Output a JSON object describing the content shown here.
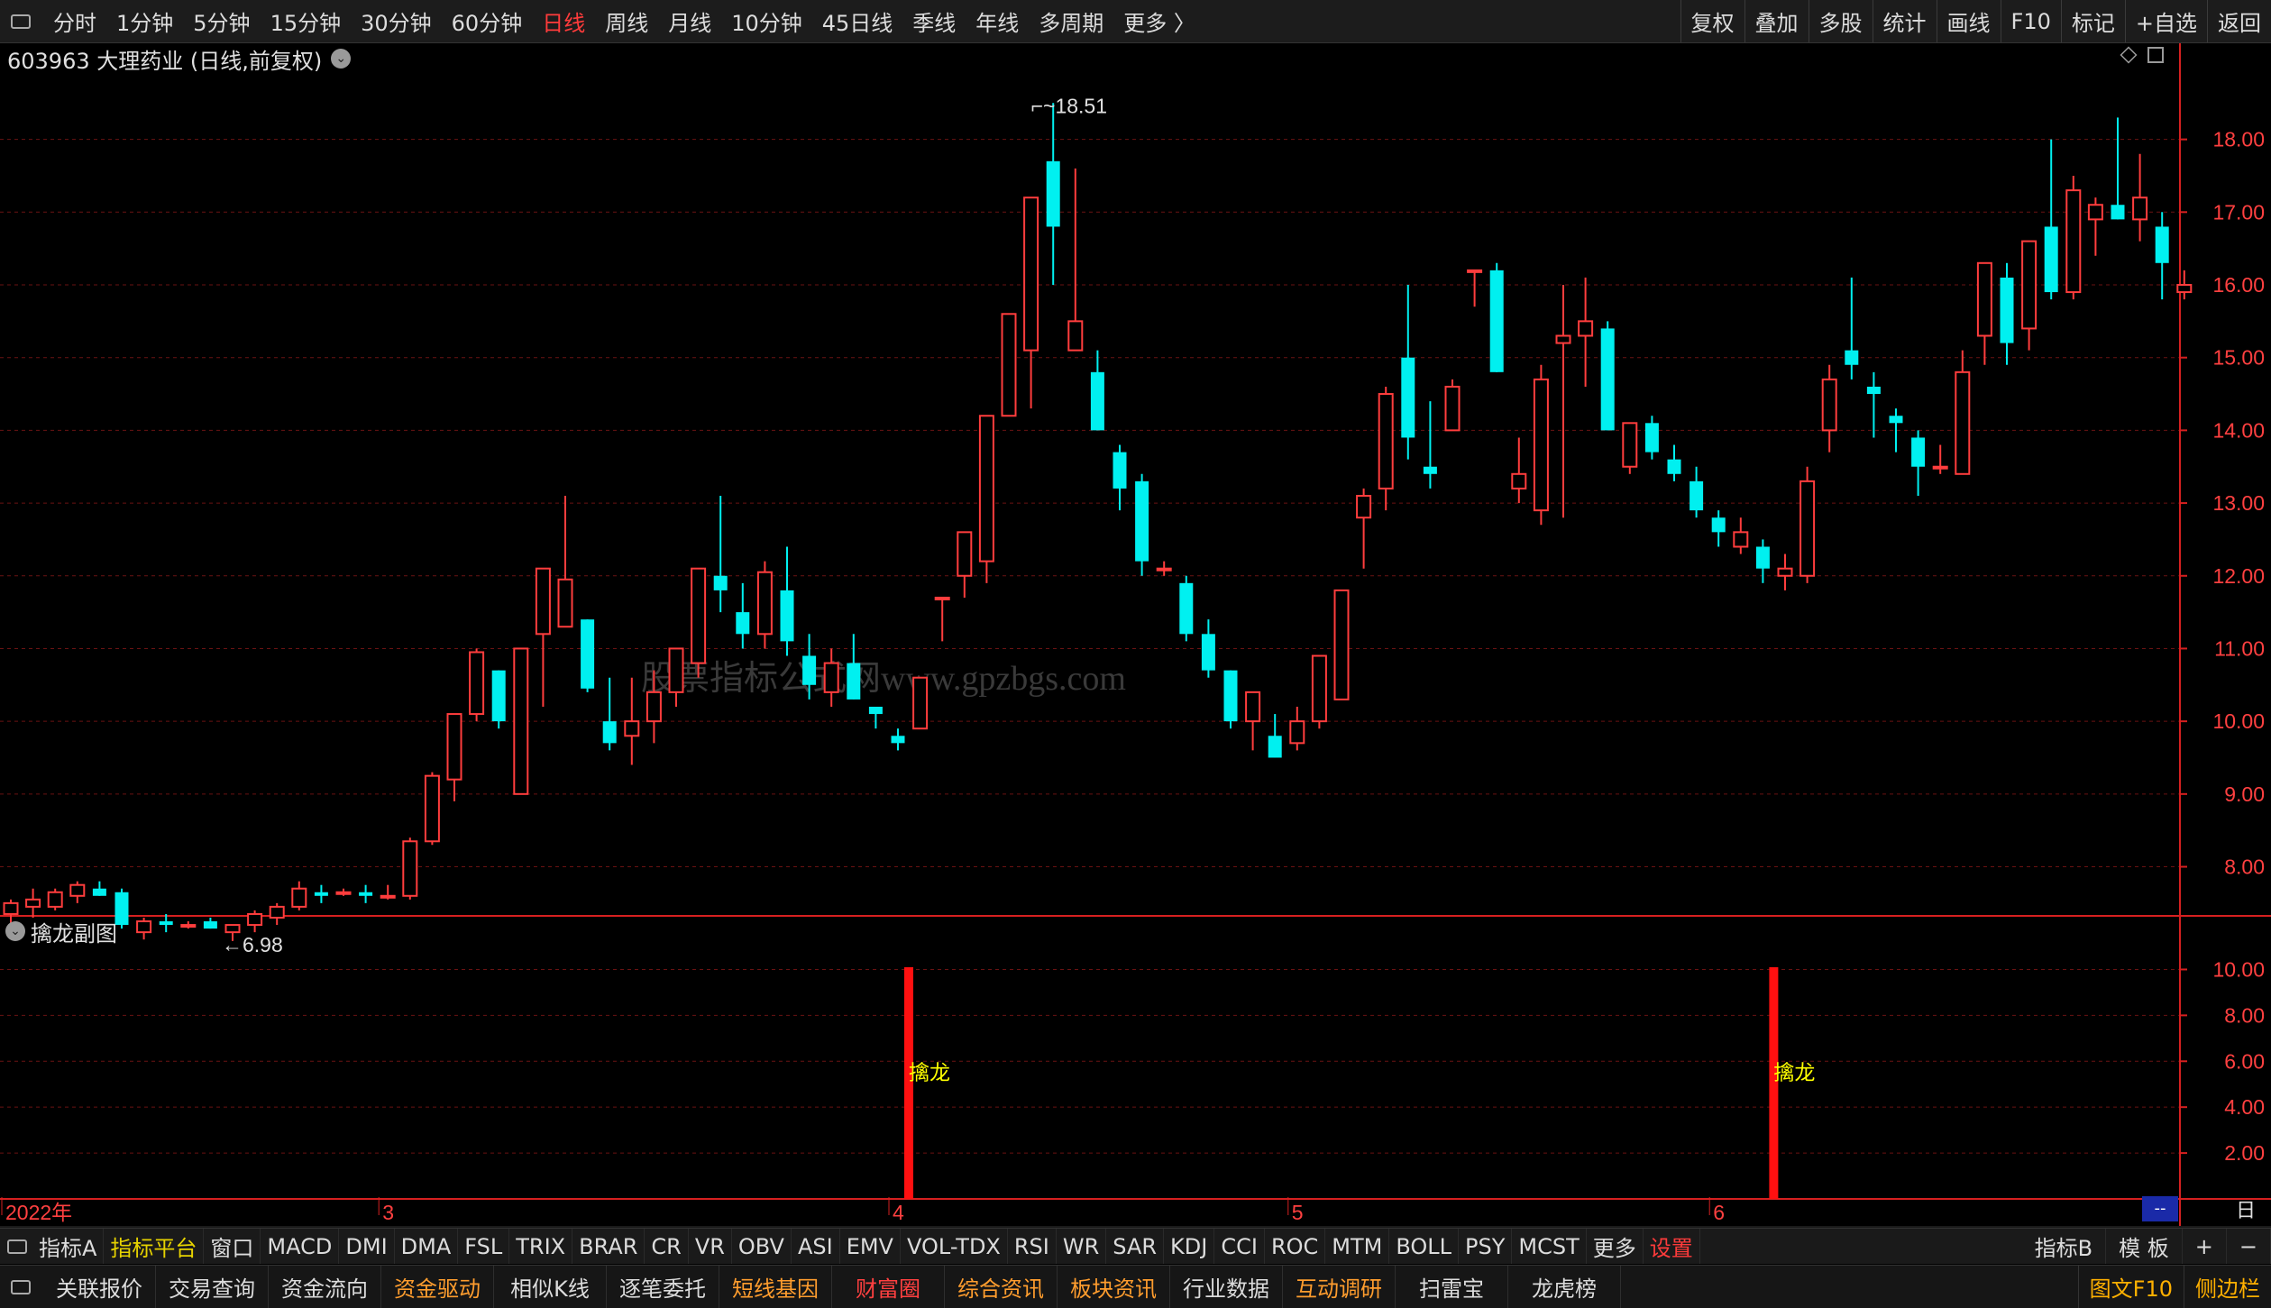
{
  "toolbar": {
    "periods": [
      {
        "label": "分时",
        "active": false
      },
      {
        "label": "1分钟",
        "active": false
      },
      {
        "label": "5分钟",
        "active": false
      },
      {
        "label": "15分钟",
        "active": false
      },
      {
        "label": "30分钟",
        "active": false
      },
      {
        "label": "60分钟",
        "active": false
      },
      {
        "label": "日线",
        "active": true
      },
      {
        "label": "周线",
        "active": false
      },
      {
        "label": "月线",
        "active": false
      },
      {
        "label": "10分钟",
        "active": false
      },
      {
        "label": "45日线",
        "active": false
      },
      {
        "label": "季线",
        "active": false
      },
      {
        "label": "年线",
        "active": false
      },
      {
        "label": "多周期",
        "active": false
      },
      {
        "label": "更多 〉",
        "active": false
      }
    ],
    "right_buttons": [
      "复权",
      "叠加",
      "多股",
      "统计",
      "画线",
      "F10",
      "标记",
      "+自选",
      "返回"
    ]
  },
  "main_title": "603963 大理药业 (日线,前复权)",
  "sub_title": "擒龙副图",
  "watermark": "股票指标公式网www.gpzbgs.com",
  "chart_data": [
    {
      "type": "candlestick",
      "ylim": [
        7.3,
        18.9
      ],
      "y_ticks": [
        8.0,
        9.0,
        10.0,
        11.0,
        12.0,
        13.0,
        14.0,
        15.0,
        16.0,
        17.0,
        18.0
      ],
      "y_tick_labels": [
        "8.00",
        "9.00",
        "10.00",
        "11.00",
        "12.00",
        "13.00",
        "14.00",
        "15.00",
        "16.00",
        "17.00",
        "18.00"
      ],
      "x_labels": [
        {
          "index": 0,
          "label": "2022年"
        },
        {
          "index": 17,
          "label": "3"
        },
        {
          "index": 40,
          "label": "4"
        },
        {
          "index": 58,
          "label": "5"
        },
        {
          "index": 77,
          "label": "6"
        }
      ],
      "annotations": [
        {
          "label": "18.51",
          "index": 46,
          "value": 18.51
        },
        {
          "label": "6.98",
          "index": 10,
          "value": 6.98
        }
      ],
      "candles": [
        {
          "o": 7.35,
          "h": 7.55,
          "l": 7.2,
          "c": 7.5
        },
        {
          "o": 7.45,
          "h": 7.7,
          "l": 7.3,
          "c": 7.55
        },
        {
          "o": 7.45,
          "h": 7.7,
          "l": 7.4,
          "c": 7.65
        },
        {
          "o": 7.6,
          "h": 7.8,
          "l": 7.5,
          "c": 7.75
        },
        {
          "o": 7.7,
          "h": 7.8,
          "l": 7.6,
          "c": 7.6
        },
        {
          "o": 7.65,
          "h": 7.7,
          "l": 7.15,
          "c": 7.2
        },
        {
          "o": 7.1,
          "h": 7.3,
          "l": 7.0,
          "c": 7.25
        },
        {
          "o": 7.25,
          "h": 7.35,
          "l": 7.1,
          "c": 7.2
        },
        {
          "o": 7.2,
          "h": 7.25,
          "l": 7.15,
          "c": 7.2
        },
        {
          "o": 7.25,
          "h": 7.3,
          "l": 7.15,
          "c": 7.15
        },
        {
          "o": 7.1,
          "h": 7.2,
          "l": 6.98,
          "c": 7.2
        },
        {
          "o": 7.2,
          "h": 7.4,
          "l": 7.1,
          "c": 7.35
        },
        {
          "o": 7.3,
          "h": 7.5,
          "l": 7.2,
          "c": 7.45
        },
        {
          "o": 7.45,
          "h": 7.8,
          "l": 7.4,
          "c": 7.7
        },
        {
          "o": 7.65,
          "h": 7.75,
          "l": 7.5,
          "c": 7.6
        },
        {
          "o": 7.65,
          "h": 7.7,
          "l": 7.6,
          "c": 7.65
        },
        {
          "o": 7.65,
          "h": 7.75,
          "l": 7.5,
          "c": 7.6
        },
        {
          "o": 7.6,
          "h": 7.75,
          "l": 7.55,
          "c": 7.6
        },
        {
          "o": 7.6,
          "h": 8.4,
          "l": 7.55,
          "c": 8.35
        },
        {
          "o": 8.35,
          "h": 9.3,
          "l": 8.3,
          "c": 9.25
        },
        {
          "o": 9.2,
          "h": 10.1,
          "l": 8.9,
          "c": 10.1
        },
        {
          "o": 10.1,
          "h": 11.0,
          "l": 10.0,
          "c": 10.95
        },
        {
          "o": 10.7,
          "h": 10.7,
          "l": 9.9,
          "c": 10.0
        },
        {
          "o": 9.0,
          "h": 11.0,
          "l": 9.0,
          "c": 11.0
        },
        {
          "o": 11.2,
          "h": 11.25,
          "l": 10.2,
          "c": 12.1
        },
        {
          "o": 11.3,
          "h": 13.1,
          "l": 11.3,
          "c": 11.95
        },
        {
          "o": 11.4,
          "h": 11.4,
          "l": 10.4,
          "c": 10.45
        },
        {
          "o": 10.0,
          "h": 10.6,
          "l": 9.6,
          "c": 9.7
        },
        {
          "o": 9.8,
          "h": 10.6,
          "l": 9.4,
          "c": 10.0
        },
        {
          "o": 10.0,
          "h": 10.7,
          "l": 9.7,
          "c": 10.4
        },
        {
          "o": 10.4,
          "h": 10.9,
          "l": 10.2,
          "c": 11.0
        },
        {
          "o": 10.8,
          "h": 12.0,
          "l": 10.6,
          "c": 12.1
        },
        {
          "o": 12.0,
          "h": 13.1,
          "l": 11.5,
          "c": 11.8
        },
        {
          "o": 11.5,
          "h": 11.9,
          "l": 11.0,
          "c": 11.2
        },
        {
          "o": 11.2,
          "h": 12.2,
          "l": 11.0,
          "c": 12.05
        },
        {
          "o": 11.8,
          "h": 12.4,
          "l": 10.9,
          "c": 11.1
        },
        {
          "o": 10.9,
          "h": 11.2,
          "l": 10.3,
          "c": 10.5
        },
        {
          "o": 10.4,
          "h": 11.0,
          "l": 10.2,
          "c": 10.8
        },
        {
          "o": 10.8,
          "h": 11.2,
          "l": 10.3,
          "c": 10.3
        },
        {
          "o": 10.2,
          "h": 10.2,
          "l": 9.9,
          "c": 10.1
        },
        {
          "o": 9.8,
          "h": 9.9,
          "l": 9.6,
          "c": 9.7
        },
        {
          "o": 9.9,
          "h": 10.6,
          "l": 9.9,
          "c": 10.6
        },
        {
          "o": 11.7,
          "h": 11.7,
          "l": 11.1,
          "c": 11.7
        },
        {
          "o": 12.0,
          "h": 12.6,
          "l": 11.7,
          "c": 12.6
        },
        {
          "o": 12.2,
          "h": 14.2,
          "l": 11.9,
          "c": 14.2
        },
        {
          "o": 14.2,
          "h": 15.6,
          "l": 14.2,
          "c": 15.6
        },
        {
          "o": 15.1,
          "h": 17.1,
          "l": 14.3,
          "c": 17.2
        },
        {
          "o": 17.7,
          "h": 18.5,
          "l": 16.0,
          "c": 16.8
        },
        {
          "o": 15.1,
          "h": 17.6,
          "l": 15.1,
          "c": 15.5
        },
        {
          "o": 14.8,
          "h": 15.1,
          "l": 14.0,
          "c": 14.0
        },
        {
          "o": 13.7,
          "h": 13.8,
          "l": 12.9,
          "c": 13.2
        },
        {
          "o": 13.3,
          "h": 13.4,
          "l": 12.0,
          "c": 12.2
        },
        {
          "o": 12.1,
          "h": 12.2,
          "l": 12.0,
          "c": 12.1
        },
        {
          "o": 11.9,
          "h": 12.0,
          "l": 11.1,
          "c": 11.2
        },
        {
          "o": 11.2,
          "h": 11.4,
          "l": 10.6,
          "c": 10.7
        },
        {
          "o": 10.7,
          "h": 10.7,
          "l": 9.9,
          "c": 10.0
        },
        {
          "o": 10.0,
          "h": 10.4,
          "l": 9.6,
          "c": 10.4
        },
        {
          "o": 9.8,
          "h": 10.1,
          "l": 9.5,
          "c": 9.5
        },
        {
          "o": 9.7,
          "h": 10.2,
          "l": 9.6,
          "c": 10.0
        },
        {
          "o": 10.0,
          "h": 10.9,
          "l": 9.9,
          "c": 10.9
        },
        {
          "o": 10.3,
          "h": 11.8,
          "l": 10.3,
          "c": 11.8
        },
        {
          "o": 12.8,
          "h": 13.2,
          "l": 12.1,
          "c": 13.1
        },
        {
          "o": 13.2,
          "h": 14.6,
          "l": 12.9,
          "c": 14.5
        },
        {
          "o": 15.0,
          "h": 16.0,
          "l": 13.6,
          "c": 13.9
        },
        {
          "o": 13.5,
          "h": 14.4,
          "l": 13.2,
          "c": 13.4
        },
        {
          "o": 14.0,
          "h": 14.7,
          "l": 14.0,
          "c": 14.6
        },
        {
          "o": 16.2,
          "h": 16.2,
          "l": 15.7,
          "c": 16.2
        },
        {
          "o": 16.2,
          "h": 16.3,
          "l": 14.8,
          "c": 14.8
        },
        {
          "o": 13.2,
          "h": 13.9,
          "l": 13.0,
          "c": 13.4
        },
        {
          "o": 12.9,
          "h": 14.9,
          "l": 12.7,
          "c": 14.7
        },
        {
          "o": 15.2,
          "h": 16.0,
          "l": 12.8,
          "c": 15.3
        },
        {
          "o": 15.3,
          "h": 16.1,
          "l": 14.6,
          "c": 15.5
        },
        {
          "o": 15.4,
          "h": 15.5,
          "l": 14.0,
          "c": 14.0
        },
        {
          "o": 13.5,
          "h": 14.1,
          "l": 13.4,
          "c": 14.1
        },
        {
          "o": 14.1,
          "h": 14.2,
          "l": 13.6,
          "c": 13.7
        },
        {
          "o": 13.6,
          "h": 13.8,
          "l": 13.3,
          "c": 13.4
        },
        {
          "o": 13.3,
          "h": 13.5,
          "l": 12.8,
          "c": 12.9
        },
        {
          "o": 12.8,
          "h": 12.9,
          "l": 12.4,
          "c": 12.6
        },
        {
          "o": 12.4,
          "h": 12.8,
          "l": 12.3,
          "c": 12.6
        },
        {
          "o": 12.4,
          "h": 12.5,
          "l": 11.9,
          "c": 12.1
        },
        {
          "o": 12.0,
          "h": 12.3,
          "l": 11.8,
          "c": 12.1
        },
        {
          "o": 12.0,
          "h": 13.5,
          "l": 11.9,
          "c": 13.3
        },
        {
          "o": 14.0,
          "h": 14.9,
          "l": 13.7,
          "c": 14.7
        },
        {
          "o": 15.1,
          "h": 16.1,
          "l": 14.7,
          "c": 14.9
        },
        {
          "o": 14.6,
          "h": 14.8,
          "l": 13.9,
          "c": 14.5
        },
        {
          "o": 14.2,
          "h": 14.3,
          "l": 13.7,
          "c": 14.1
        },
        {
          "o": 13.9,
          "h": 14.0,
          "l": 13.1,
          "c": 13.5
        },
        {
          "o": 13.5,
          "h": 13.8,
          "l": 13.4,
          "c": 13.5
        },
        {
          "o": 13.4,
          "h": 15.1,
          "l": 13.4,
          "c": 14.8
        },
        {
          "o": 15.3,
          "h": 16.3,
          "l": 14.9,
          "c": 16.3
        },
        {
          "o": 16.1,
          "h": 16.3,
          "l": 14.9,
          "c": 15.2
        },
        {
          "o": 15.4,
          "h": 16.6,
          "l": 15.1,
          "c": 16.6
        },
        {
          "o": 16.8,
          "h": 18.0,
          "l": 15.8,
          "c": 15.9
        },
        {
          "o": 15.9,
          "h": 17.5,
          "l": 15.8,
          "c": 17.3
        },
        {
          "o": 16.9,
          "h": 17.2,
          "l": 16.4,
          "c": 17.1
        },
        {
          "o": 17.1,
          "h": 18.3,
          "l": 16.9,
          "c": 16.9
        },
        {
          "o": 16.9,
          "h": 17.8,
          "l": 16.6,
          "c": 17.2
        },
        {
          "o": 16.8,
          "h": 17.0,
          "l": 15.8,
          "c": 16.3
        },
        {
          "o": 15.9,
          "h": 16.2,
          "l": 15.8,
          "c": 16.0
        }
      ]
    },
    {
      "type": "bar",
      "title": "擒龙副图",
      "ylim": [
        0,
        11
      ],
      "y_tick_labels": [
        "2.00",
        "4.00",
        "6.00",
        "8.00",
        "10.00"
      ],
      "y_ticks": [
        2,
        4,
        6,
        8,
        10
      ],
      "series": [
        {
          "name": "擒龙",
          "points": [
            {
              "index": 40,
              "value": 10.1
            },
            {
              "index": 79,
              "value": 10.1
            }
          ]
        }
      ],
      "bar_label": "擒龙"
    }
  ],
  "indicator_tabs": [
    {
      "label": "指标A",
      "style": "normal"
    },
    {
      "label": "指标平台",
      "style": "yellow"
    },
    {
      "label": "窗口",
      "style": "normal"
    },
    {
      "label": "MACD",
      "style": "normal"
    },
    {
      "label": "DMI",
      "style": "normal"
    },
    {
      "label": "DMA",
      "style": "normal"
    },
    {
      "label": "FSL",
      "style": "normal"
    },
    {
      "label": "TRIX",
      "style": "normal"
    },
    {
      "label": "BRAR",
      "style": "normal"
    },
    {
      "label": "CR",
      "style": "normal"
    },
    {
      "label": "VR",
      "style": "normal"
    },
    {
      "label": "OBV",
      "style": "normal"
    },
    {
      "label": "ASI",
      "style": "normal"
    },
    {
      "label": "EMV",
      "style": "normal"
    },
    {
      "label": "VOL-TDX",
      "style": "normal"
    },
    {
      "label": "RSI",
      "style": "normal"
    },
    {
      "label": "WR",
      "style": "normal"
    },
    {
      "label": "SAR",
      "style": "normal"
    },
    {
      "label": "KDJ",
      "style": "normal"
    },
    {
      "label": "CCI",
      "style": "normal"
    },
    {
      "label": "ROC",
      "style": "normal"
    },
    {
      "label": "MTM",
      "style": "normal"
    },
    {
      "label": "BOLL",
      "style": "normal"
    },
    {
      "label": "PSY",
      "style": "normal"
    },
    {
      "label": "MCST",
      "style": "normal"
    },
    {
      "label": "更多",
      "style": "normal"
    },
    {
      "label": "设置",
      "style": "red"
    }
  ],
  "indicator_right": [
    "指标B",
    "模 板",
    "+",
    "−"
  ],
  "period_label": "日线",
  "dash_label": "--",
  "bottom_buttons": [
    {
      "label": "关联报价",
      "color": "#dcdcdc"
    },
    {
      "label": "交易查询",
      "color": "#dcdcdc"
    },
    {
      "label": "资金流向",
      "color": "#dcdcdc"
    },
    {
      "label": "资金驱动",
      "color": "#ff9d2e"
    },
    {
      "label": "相似K线",
      "color": "#dcdcdc"
    },
    {
      "label": "逐笔委托",
      "color": "#dcdcdc"
    },
    {
      "label": "短线基因",
      "color": "#ff9d2e"
    },
    {
      "label": "财富圈",
      "color": "#ff4040"
    },
    {
      "label": "综合资讯",
      "color": "#ff9d2e"
    },
    {
      "label": "板块资讯",
      "color": "#ff9d2e"
    },
    {
      "label": "行业数据",
      "color": "#dcdcdc"
    },
    {
      "label": "互动调研",
      "color": "#ff9d2e"
    },
    {
      "label": "扫雷宝",
      "color": "#dcdcdc"
    },
    {
      "label": "龙虎榜",
      "color": "#dcdcdc"
    }
  ],
  "bottom_right": [
    "图文F10",
    "侧边栏"
  ],
  "colors": {
    "up": "#ff3d3d",
    "down": "#00f0f0",
    "grid": "#6a1212",
    "axis": "#d62020",
    "axis_text": "#ff4040",
    "signal_bar": "#ff1010",
    "signal_label": "#ffff00"
  }
}
